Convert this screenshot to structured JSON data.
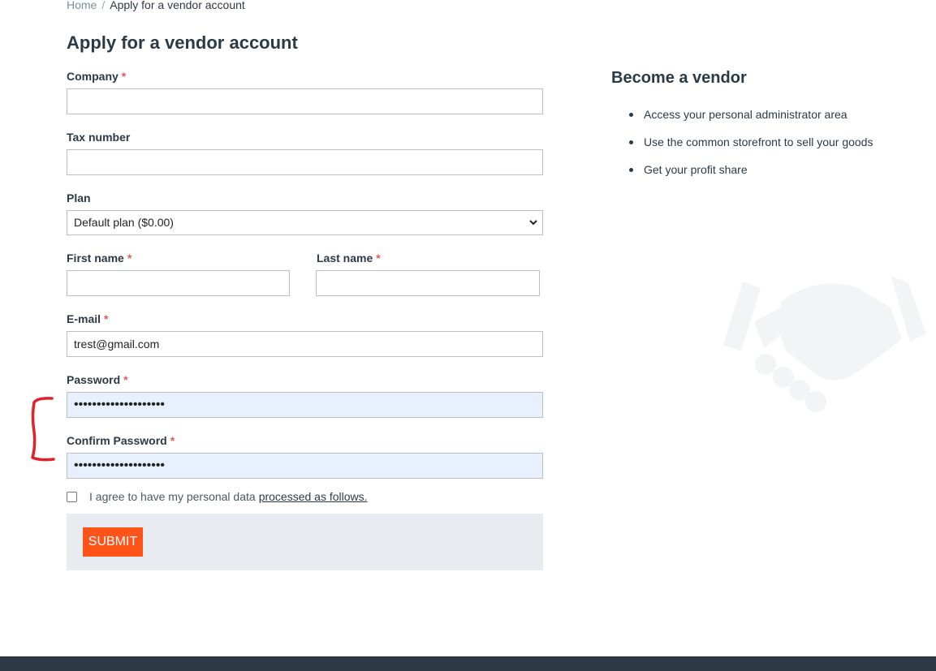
{
  "breadcrumb": {
    "home": "Home",
    "separator": "/",
    "current": "Apply for a vendor account"
  },
  "page_title": "Apply for a vendor account",
  "form": {
    "company": {
      "label": "Company",
      "required_mark": "*",
      "value": ""
    },
    "tax_number": {
      "label": "Tax number",
      "value": ""
    },
    "plan": {
      "label": "Plan",
      "selected": "Default plan ($0.00)"
    },
    "first_name": {
      "label": "First name",
      "required_mark": "*",
      "value": ""
    },
    "last_name": {
      "label": "Last name",
      "required_mark": "*",
      "value": ""
    },
    "email": {
      "label": "E-mail",
      "required_mark": "*",
      "value": "trest@gmail.com"
    },
    "password": {
      "label": "Password",
      "required_mark": "*",
      "value": "••••••••••••••••••••"
    },
    "confirm_password": {
      "label": "Confirm Password",
      "required_mark": "*",
      "value": "••••••••••••••••••••"
    },
    "agree": {
      "text": "I agree to have my personal data",
      "link": "processed as follows."
    },
    "submit_label": "SUBMIT"
  },
  "aside": {
    "title": "Become a vendor",
    "benefits": [
      "Access your personal administrator area",
      "Use the common storefront to sell your goods",
      "Get your profit share"
    ]
  },
  "icons": {
    "plan_dropdown": "chevron-down-icon",
    "illustration": "handshake-icon",
    "annotation": "bracket-annotation"
  },
  "colors": {
    "accent": "#ff5319",
    "text": "#2c3a46",
    "footer": "#2c3a46",
    "required": "#e05a5a",
    "autofill": "#e8f0fe",
    "annotation": "#e0202a"
  }
}
